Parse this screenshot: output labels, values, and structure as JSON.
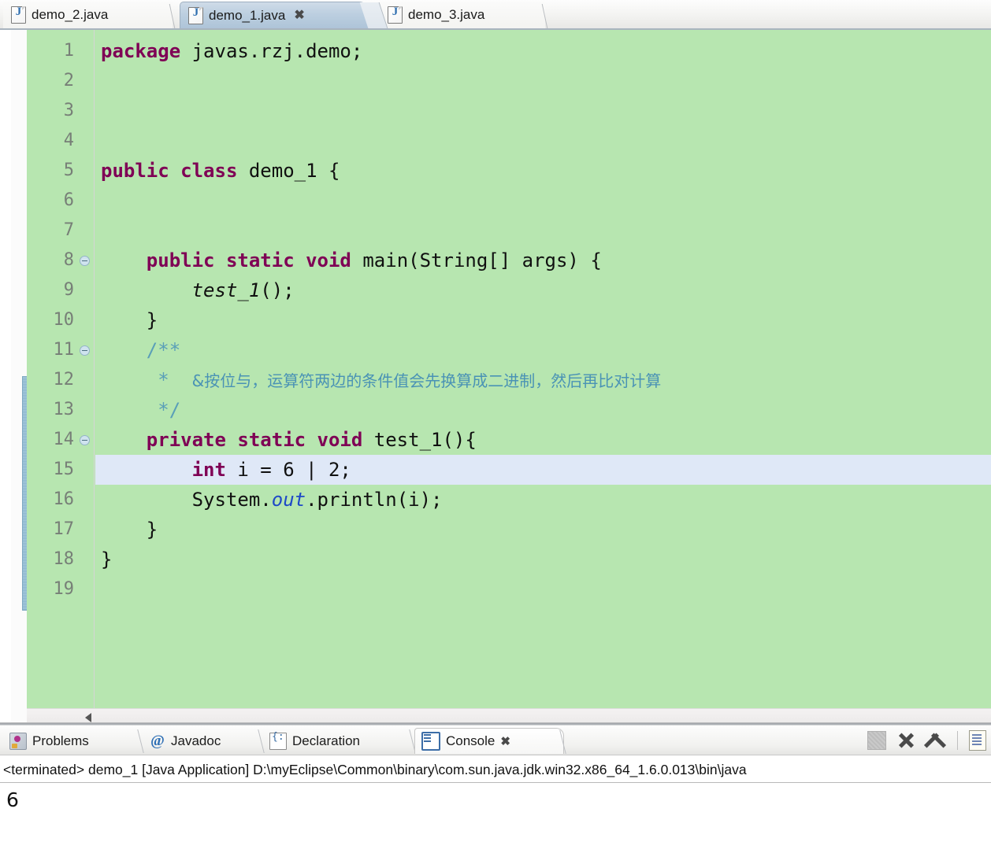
{
  "editor_tabs": [
    {
      "label": "demo_2.java",
      "icon": "java-file-icon",
      "active": false,
      "closable": false
    },
    {
      "label": "demo_1.java",
      "icon": "java-file-icon",
      "active": true,
      "closable": true,
      "close_glyph": "✖"
    },
    {
      "label": "demo_3.java",
      "icon": "java-file-icon",
      "active": false,
      "closable": false
    }
  ],
  "code": {
    "language": "java",
    "background_color": "#b7e6b0",
    "current_line": 15,
    "current_line_color": "#dfe8f7",
    "keyword_color": "#7f0055",
    "comment_color": "#5a9fb8",
    "field_color": "#1e49c7",
    "lines": [
      {
        "n": "1",
        "fold": false,
        "indent": 0,
        "tokens": [
          {
            "t": "package ",
            "c": "kw"
          },
          {
            "t": "javas.rzj.demo;",
            "c": ""
          }
        ]
      },
      {
        "n": "2",
        "fold": false,
        "indent": 0,
        "tokens": []
      },
      {
        "n": "3",
        "fold": false,
        "indent": 0,
        "tokens": []
      },
      {
        "n": "4",
        "fold": false,
        "indent": 0,
        "tokens": []
      },
      {
        "n": "5",
        "fold": false,
        "indent": 0,
        "tokens": [
          {
            "t": "public class ",
            "c": "kw"
          },
          {
            "t": "demo_1 {",
            "c": ""
          }
        ]
      },
      {
        "n": "6",
        "fold": false,
        "indent": 0,
        "tokens": []
      },
      {
        "n": "7",
        "fold": false,
        "indent": 0,
        "tokens": []
      },
      {
        "n": "8",
        "fold": true,
        "indent": 1,
        "tokens": [
          {
            "t": "public static void ",
            "c": "kw"
          },
          {
            "t": "main(String[] args) {",
            "c": ""
          }
        ]
      },
      {
        "n": "9",
        "fold": false,
        "indent": 2,
        "tokens": [
          {
            "t": "test_1",
            "c": "stat"
          },
          {
            "t": "();",
            "c": ""
          }
        ]
      },
      {
        "n": "10",
        "fold": false,
        "indent": 1,
        "tokens": [
          {
            "t": "}",
            "c": ""
          }
        ]
      },
      {
        "n": "11",
        "fold": true,
        "indent": 1,
        "tokens": [
          {
            "t": "/**",
            "c": "cmt"
          }
        ]
      },
      {
        "n": "12",
        "fold": false,
        "indent": 1,
        "tokens": [
          {
            "t": " *  ",
            "c": "cmt"
          },
          {
            "t": "&按位与，运算符两边的条件值会先换算成二进制，然后再比对计算",
            "c": "cmt-cn"
          }
        ]
      },
      {
        "n": "13",
        "fold": false,
        "indent": 1,
        "tokens": [
          {
            "t": " */",
            "c": "cmt"
          }
        ]
      },
      {
        "n": "14",
        "fold": true,
        "indent": 1,
        "tokens": [
          {
            "t": "private static void ",
            "c": "kw"
          },
          {
            "t": "test_1(){",
            "c": ""
          }
        ]
      },
      {
        "n": "15",
        "fold": false,
        "indent": 2,
        "highlight": true,
        "tokens": [
          {
            "t": "int ",
            "c": "kw"
          },
          {
            "t": "i = 6 | 2;",
            "c": ""
          }
        ]
      },
      {
        "n": "16",
        "fold": false,
        "indent": 2,
        "tokens": [
          {
            "t": "System.",
            "c": ""
          },
          {
            "t": "out",
            "c": "field"
          },
          {
            "t": ".println(i);",
            "c": ""
          }
        ]
      },
      {
        "n": "17",
        "fold": false,
        "indent": 1,
        "tokens": [
          {
            "t": "}",
            "c": ""
          }
        ]
      },
      {
        "n": "18",
        "fold": false,
        "indent": 0,
        "tokens": [
          {
            "t": "}",
            "c": ""
          }
        ]
      },
      {
        "n": "19",
        "fold": false,
        "indent": 0,
        "tokens": []
      }
    ]
  },
  "console": {
    "tabs": [
      {
        "label": "Problems",
        "icon": "problems-icon",
        "active": false
      },
      {
        "label": "Javadoc",
        "icon": "at-sign-icon",
        "active": false
      },
      {
        "label": "Declaration",
        "icon": "declaration-icon",
        "active": false
      },
      {
        "label": "Console",
        "icon": "console-icon",
        "active": true,
        "close_glyph": "✖"
      }
    ],
    "toolbar": [
      {
        "name": "terminate-button",
        "tooltip": "Terminate"
      },
      {
        "name": "remove-launch-button",
        "tooltip": "Remove Launch"
      },
      {
        "name": "remove-all-terminated-button",
        "tooltip": "Remove All Terminated Launches"
      },
      {
        "name": "open-console-button",
        "tooltip": "Open Console"
      }
    ],
    "status_line": "<terminated> demo_1 [Java Application] D:\\myEclipse\\Common\\binary\\com.sun.java.jdk.win32.x86_64_1.6.0.013\\bin\\java",
    "output": "6"
  }
}
